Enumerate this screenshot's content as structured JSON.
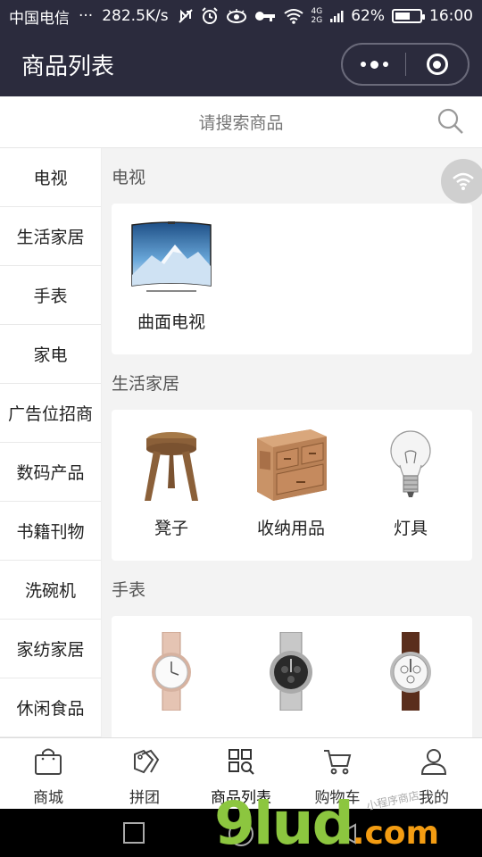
{
  "status_bar": {
    "carrier": "中国电信",
    "dots": "···",
    "speed": "282.5K/s",
    "network_4g": "4G",
    "network_2g": "2G",
    "battery": "62%",
    "battery_level": 0.62,
    "time": "16:00"
  },
  "title_bar": {
    "title": "商品列表"
  },
  "search": {
    "placeholder": "请搜索商品"
  },
  "sidebar": {
    "items": [
      {
        "label": "电视"
      },
      {
        "label": "生活家居"
      },
      {
        "label": "手表"
      },
      {
        "label": "家电"
      },
      {
        "label": "广告位招商"
      },
      {
        "label": "数码产品"
      },
      {
        "label": "书籍刊物"
      },
      {
        "label": "洗碗机"
      },
      {
        "label": "家纺家居"
      },
      {
        "label": "休闲食品"
      }
    ]
  },
  "sections": [
    {
      "title": "电视",
      "products": [
        {
          "name": "曲面电视",
          "icon": "curved-tv-image"
        }
      ]
    },
    {
      "title": "生活家居",
      "products": [
        {
          "name": "凳子",
          "icon": "stool-image"
        },
        {
          "name": "收纳用品",
          "icon": "storage-box-image"
        },
        {
          "name": "灯具",
          "icon": "light-bulb-image"
        }
      ]
    },
    {
      "title": "手表",
      "products": [
        {
          "name": "",
          "icon": "rose-gold-watch-image"
        },
        {
          "name": "",
          "icon": "steel-chronograph-watch-image"
        },
        {
          "name": "",
          "icon": "leather-strap-watch-image"
        }
      ]
    }
  ],
  "tab_bar": {
    "tabs": [
      {
        "label": "商城",
        "icon": "shopping-bag-icon"
      },
      {
        "label": "拼团",
        "icon": "tag-group-icon"
      },
      {
        "label": "商品列表",
        "icon": "grid-search-icon",
        "active": true
      },
      {
        "label": "购物车",
        "icon": "cart-icon"
      },
      {
        "label": "我的",
        "icon": "user-icon"
      }
    ]
  },
  "watermark": {
    "brand": "9lud",
    "domain": ".com",
    "small": "小程序商店"
  },
  "colors": {
    "header_bg": "#2b2b3d",
    "page_bg": "#f3f3f3",
    "watermark_green": "#8cc63f",
    "watermark_orange": "#f39c12"
  }
}
